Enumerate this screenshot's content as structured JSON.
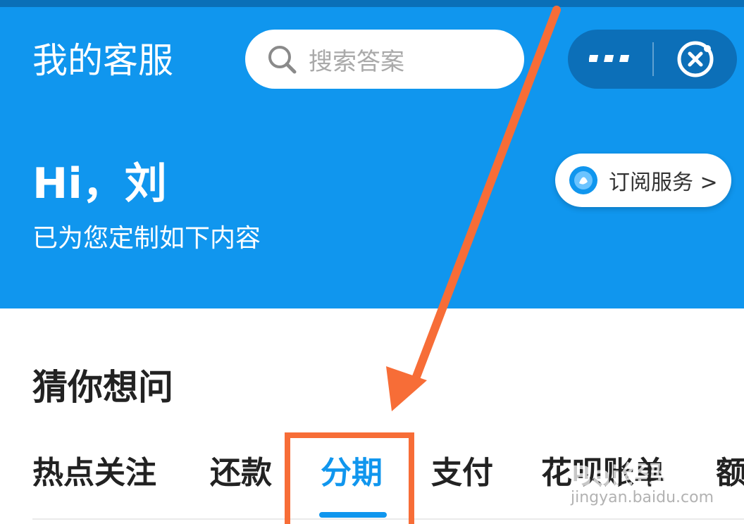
{
  "header": {
    "title": "我的客服",
    "search_placeholder": "搜索答案"
  },
  "greeting": {
    "hello": "Hi，刘",
    "subtitle": "已为您定制如下内容"
  },
  "subscribe": {
    "label": "订阅服务 >"
  },
  "section": {
    "title": "猜你想问"
  },
  "tabs": [
    {
      "label": "热点关注"
    },
    {
      "label": "还款"
    },
    {
      "label": "分期"
    },
    {
      "label": "支付"
    },
    {
      "label": "花呗账单"
    },
    {
      "label": "额"
    }
  ],
  "active_tab": "分期",
  "watermark": {
    "text": "Bai经验",
    "url": "jingyan.baidu.com"
  },
  "colors": {
    "header_bg": "#1096ee",
    "active_tab": "#1096ee",
    "annotation": "#f76d37"
  },
  "icons": {
    "search": "search-icon",
    "more": "more-dots-icon",
    "close": "close-circle-icon",
    "subscribe": "subscribe-badge-icon"
  }
}
